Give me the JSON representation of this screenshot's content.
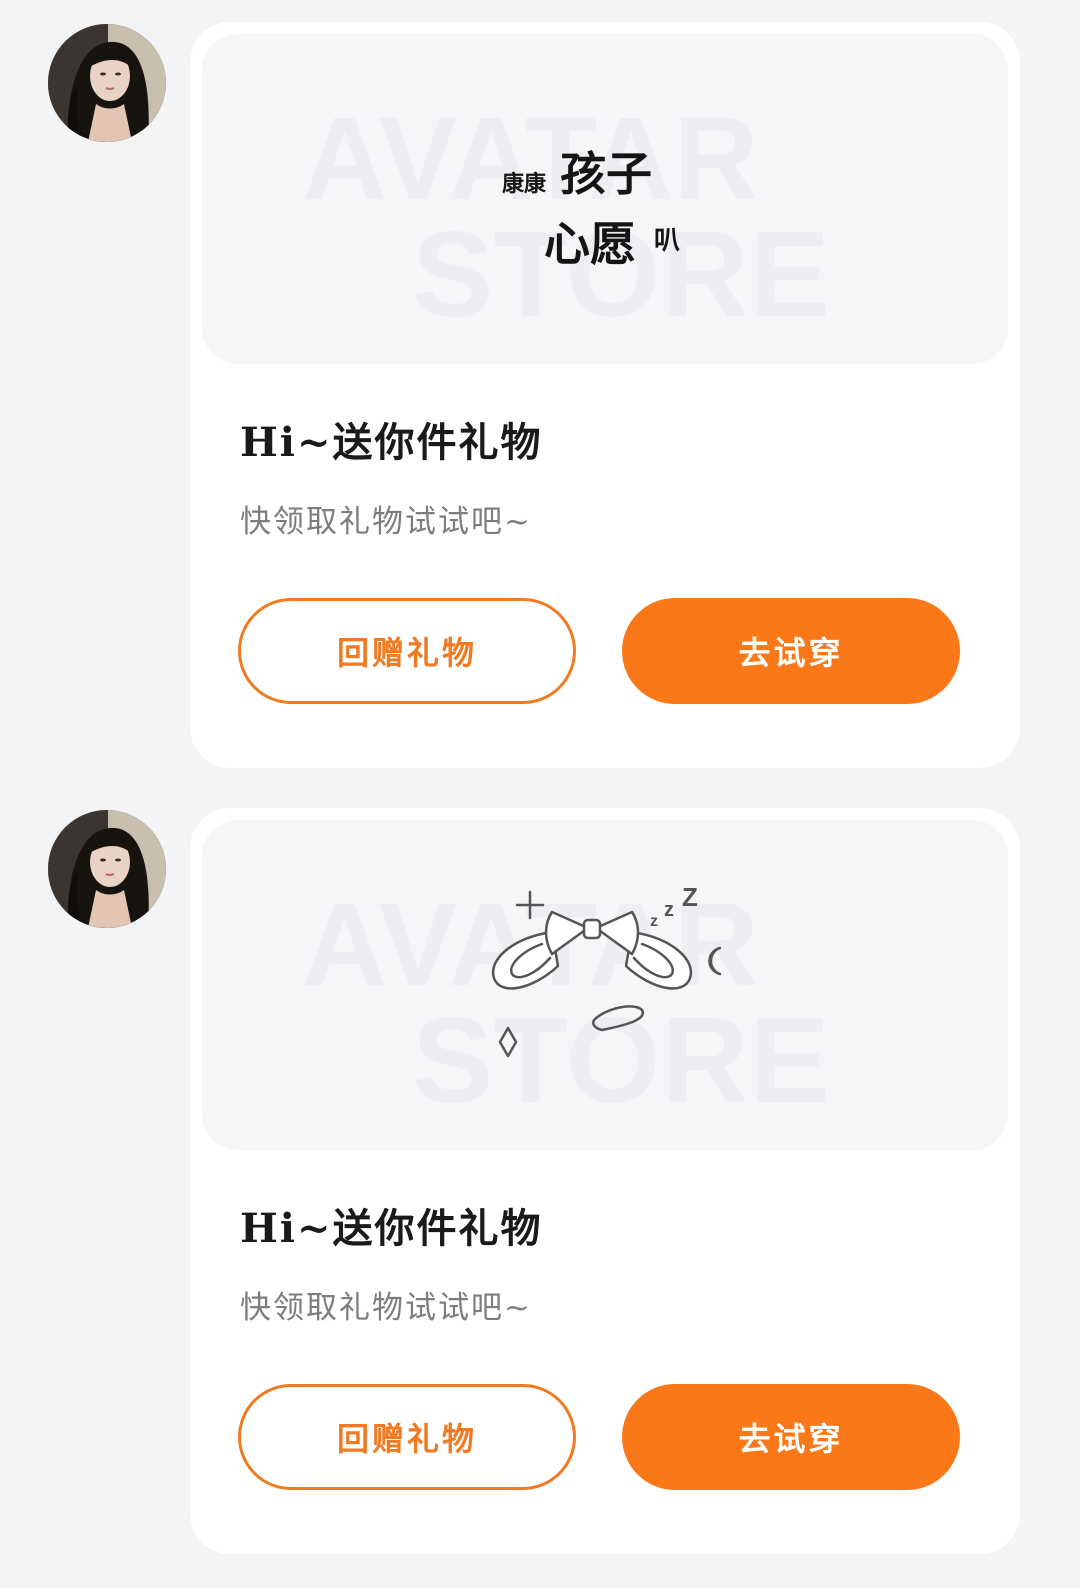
{
  "messages": [
    {
      "sticker": {
        "type": "text",
        "parts": [
          "康康",
          "孩子",
          "心愿",
          "叭"
        ]
      },
      "watermark": [
        "AVATAR",
        "STORE"
      ],
      "title": "Hi~送你件礼物",
      "subtitle": "快领取礼物试试吧~",
      "buttons": {
        "return_gift": "回赠礼物",
        "try_on": "去试穿"
      }
    },
    {
      "sticker": {
        "type": "bow-icon"
      },
      "watermark": [
        "AVATAR",
        "STORE"
      ],
      "title": "Hi~送你件礼物",
      "subtitle": "快领取礼物试试吧~",
      "buttons": {
        "return_gift": "回赠礼物",
        "try_on": "去试穿"
      }
    }
  ],
  "colors": {
    "accent": "#fb7818",
    "accent_outline": "#f07a22",
    "background": "#f3f4f6",
    "card": "#ffffff",
    "title": "#1a1a1a",
    "subtitle": "#7d7d7d"
  }
}
